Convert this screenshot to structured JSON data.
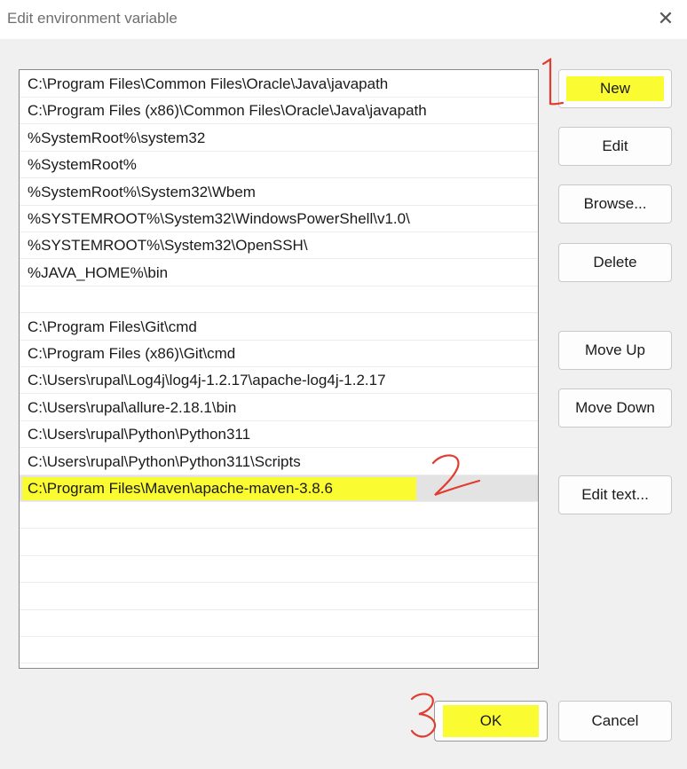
{
  "window": {
    "title": "Edit environment variable",
    "close_label": "✕"
  },
  "list": {
    "items": [
      {
        "text": "C:\\Program Files\\Common Files\\Oracle\\Java\\javapath"
      },
      {
        "text": "C:\\Program Files (x86)\\Common Files\\Oracle\\Java\\javapath"
      },
      {
        "text": "%SystemRoot%\\system32"
      },
      {
        "text": "%SystemRoot%"
      },
      {
        "text": "%SystemRoot%\\System32\\Wbem"
      },
      {
        "text": "%SYSTEMROOT%\\System32\\WindowsPowerShell\\v1.0\\"
      },
      {
        "text": "%SYSTEMROOT%\\System32\\OpenSSH\\"
      },
      {
        "text": "%JAVA_HOME%\\bin"
      },
      {
        "text": ""
      },
      {
        "text": "C:\\Program Files\\Git\\cmd"
      },
      {
        "text": "C:\\Program Files (x86)\\Git\\cmd"
      },
      {
        "text": "C:\\Users\\rupal\\Log4j\\log4j-1.2.17\\apache-log4j-1.2.17"
      },
      {
        "text": "C:\\Users\\rupal\\allure-2.18.1\\bin"
      },
      {
        "text": "C:\\Users\\rupal\\Python\\Python311"
      },
      {
        "text": "C:\\Users\\rupal\\Python\\Python311\\Scripts"
      },
      {
        "text": "C:\\Program Files\\Maven\\apache-maven-3.8.6"
      }
    ],
    "selected_index": 15,
    "empty_rows": 7
  },
  "buttons": {
    "new": "New",
    "edit": "Edit",
    "browse": "Browse...",
    "delete": "Delete",
    "move_up": "Move Up",
    "move_down": "Move Down",
    "edit_text": "Edit text...",
    "ok": "OK",
    "cancel": "Cancel"
  },
  "annotations": {
    "step1": "1",
    "step2": "2",
    "step3": "3"
  },
  "colors": {
    "highlight": "#fbfb32",
    "annotation": "#e23b2f",
    "selection": "#e3e3e3"
  }
}
